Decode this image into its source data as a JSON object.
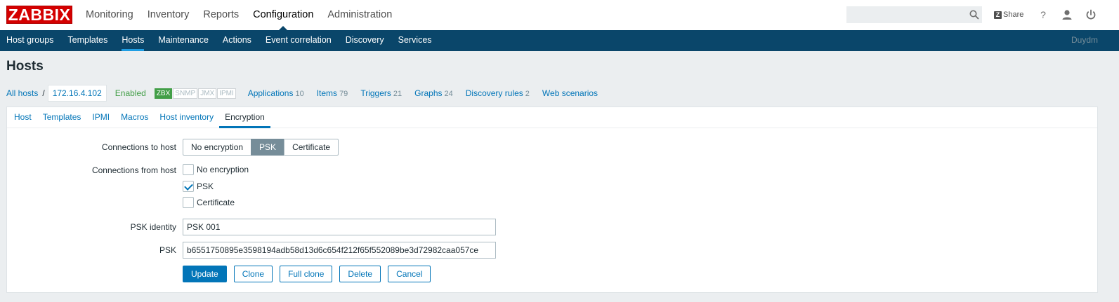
{
  "header": {
    "logo": "ZABBIX",
    "main_menu": [
      "Monitoring",
      "Inventory",
      "Reports",
      "Configuration",
      "Administration"
    ],
    "selected_main": "Configuration",
    "search": {
      "value": "",
      "placeholder": ""
    },
    "share_label": "Share",
    "help_label": "?"
  },
  "submenu": {
    "items": [
      "Host groups",
      "Templates",
      "Hosts",
      "Maintenance",
      "Actions",
      "Event correlation",
      "Discovery",
      "Services"
    ],
    "selected": "Hosts",
    "server_name": "Duydm"
  },
  "page": {
    "title": "Hosts"
  },
  "host_nav": {
    "all_hosts": "All hosts",
    "separator": "/",
    "current_host": "172.16.4.102",
    "status": "Enabled",
    "badges": [
      {
        "label": "ZBX",
        "active": true
      },
      {
        "label": "SNMP",
        "active": false
      },
      {
        "label": "JMX",
        "active": false
      },
      {
        "label": "IPMI",
        "active": false
      }
    ],
    "links": [
      {
        "label": "Applications",
        "count": "10"
      },
      {
        "label": "Items",
        "count": "79"
      },
      {
        "label": "Triggers",
        "count": "21"
      },
      {
        "label": "Graphs",
        "count": "24"
      },
      {
        "label": "Discovery rules",
        "count": "2"
      },
      {
        "label": "Web scenarios",
        "count": ""
      }
    ]
  },
  "tabs": [
    "Host",
    "Templates",
    "IPMI",
    "Macros",
    "Host inventory",
    "Encryption"
  ],
  "active_tab": "Encryption",
  "form": {
    "connections_to_host": {
      "label": "Connections to host",
      "options": [
        "No encryption",
        "PSK",
        "Certificate"
      ],
      "selected": "PSK"
    },
    "connections_from_host": {
      "label": "Connections from host",
      "options": [
        {
          "label": "No encryption",
          "checked": false
        },
        {
          "label": "PSK",
          "checked": true
        },
        {
          "label": "Certificate",
          "checked": false
        }
      ]
    },
    "psk_identity": {
      "label": "PSK identity",
      "value": "PSK 001"
    },
    "psk": {
      "label": "PSK",
      "value": "b6551750895e3598194adb58d13d6c654f212f65f552089be3d72982caa057ce"
    }
  },
  "buttons": {
    "update": "Update",
    "clone": "Clone",
    "full_clone": "Full clone",
    "delete": "Delete",
    "cancel": "Cancel"
  },
  "colors": {
    "brand_red": "#d40000",
    "submenu_bg": "#0a466a",
    "link": "#0275b8",
    "enabled_green": "#429e47"
  }
}
